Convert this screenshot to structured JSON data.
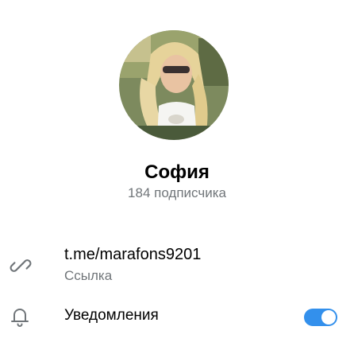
{
  "profile": {
    "name": "София",
    "subscribers": "184 подписчика"
  },
  "link_row": {
    "value": "t.me/marafons9201",
    "caption": "Ссылка",
    "icon": "link-icon"
  },
  "notifications_row": {
    "label": "Уведомления",
    "icon": "bell-icon",
    "enabled": true
  },
  "colors": {
    "accent": "#3390ec",
    "secondary_text": "#707579",
    "primary_text": "#000000",
    "background": "#ffffff"
  }
}
